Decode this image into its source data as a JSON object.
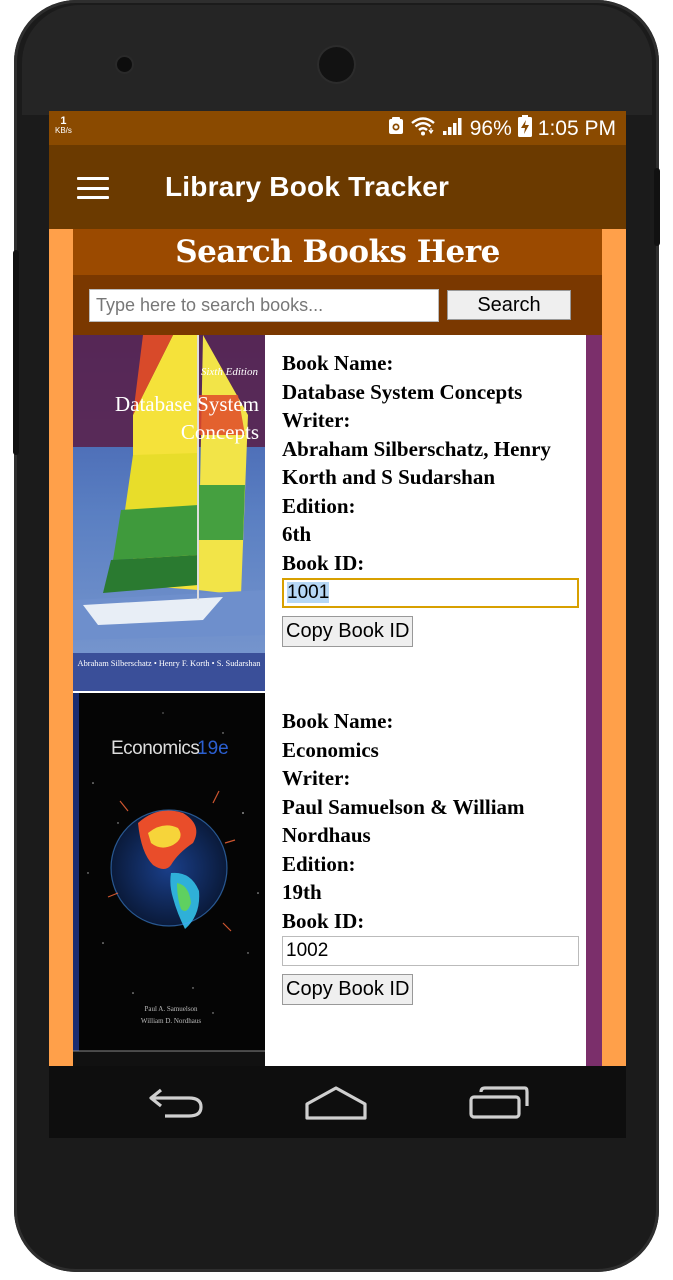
{
  "status_bar": {
    "speed_value": "1",
    "speed_unit": "KB/s",
    "battery": "96%",
    "time": "1:05 PM",
    "icons": [
      "screenshot-icon",
      "wifi-icon",
      "signal-icon",
      "battery-charging-icon"
    ]
  },
  "app_bar": {
    "title": "Library Book Tracker",
    "menu_icon": "hamburger-menu-icon"
  },
  "search": {
    "heading": "Search Books Here",
    "placeholder": "Type here to search books...",
    "button_label": "Search"
  },
  "labels": {
    "book_name": "Book Name:",
    "writer": "Writer:",
    "edition": "Edition:",
    "book_id": "Book ID:",
    "copy_button": "Copy Book ID"
  },
  "books": [
    {
      "name": "Database System Concepts",
      "writer": "Abraham Silberschatz, Henry Korth and S Sudarshan",
      "edition": "6th",
      "book_id": "1001",
      "cover": {
        "edition_text": "Sixth Edition",
        "title_line1": "Database System",
        "title_line2": "Concepts",
        "authors": "Abraham Silberschatz • Henry F. Korth • S. Sudarshan"
      }
    },
    {
      "name": "Economics",
      "writer": "Paul Samuelson & William Nordhaus",
      "edition": "19th",
      "book_id": "1002",
      "cover": {
        "title": "Economics",
        "edition_text": "19e",
        "author1": "Paul A. Samuelson",
        "author2": "William D. Nordhaus"
      }
    }
  ],
  "colors": {
    "status_bar": "#8a4a00",
    "app_bar": "#6b3a00",
    "search_heading": "#9b4a00",
    "search_row": "#7a3800",
    "side_margin": "#ffa04a",
    "scroll_accent": "#7b2f6b"
  },
  "nav_bar": {
    "icons": [
      "back-icon",
      "home-icon",
      "recents-icon"
    ]
  }
}
